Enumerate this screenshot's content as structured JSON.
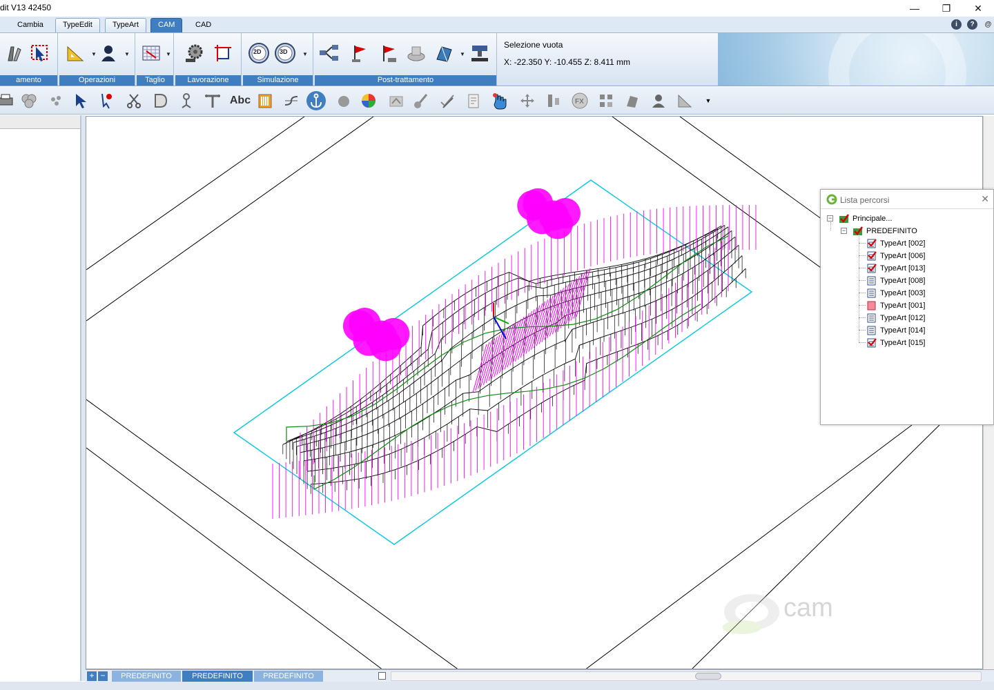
{
  "window": {
    "title": "dit V13 42450",
    "min_glyph": "—",
    "max_glyph": "❐",
    "close_glyph": "✕"
  },
  "menu_tabs": [
    {
      "label": "Cambia",
      "state": "plain"
    },
    {
      "label": "TypeEdit",
      "state": "framed"
    },
    {
      "label": "TypeArt",
      "state": "framed"
    },
    {
      "label": "CAM",
      "state": "active"
    },
    {
      "label": "CAD",
      "state": "plain"
    }
  ],
  "help_icons": [
    "i",
    "?",
    "@"
  ],
  "ribbon": {
    "groups": [
      {
        "label": "amento"
      },
      {
        "label": "Operazioni"
      },
      {
        "label": "Taglio"
      },
      {
        "label": "Lavorazione"
      },
      {
        "label": "Simulazione"
      },
      {
        "label": "Post-trattamento"
      }
    ],
    "selection_text": "Selezione vuota",
    "coords_text": "X: -22.350   Y: -10.455   Z: 8.411  mm",
    "sim2d_label": "2D",
    "sim3d_label": "3D"
  },
  "toolbar": {
    "abc_label": "Abc"
  },
  "lista_percorsi": {
    "title": "Lista percorsi",
    "close_glyph": "✕",
    "root": "Principale...",
    "group": "PREDEFINITO",
    "items": [
      {
        "label": "TypeArt [002]",
        "icon": "checked-doc-icon"
      },
      {
        "label": "TypeArt [006]",
        "icon": "checked-doc-icon"
      },
      {
        "label": "TypeArt [013]",
        "icon": "checked-doc-icon"
      },
      {
        "label": "TypeArt [008]",
        "icon": "doc-icon"
      },
      {
        "label": "TypeArt [003]",
        "icon": "doc-icon"
      },
      {
        "label": "TypeArt [001]",
        "icon": "red-doc-icon"
      },
      {
        "label": "TypeArt [012]",
        "icon": "doc-icon"
      },
      {
        "label": "TypeArt [014]",
        "icon": "doc-icon"
      },
      {
        "label": "TypeArt [015]",
        "icon": "checked-doc-icon"
      }
    ]
  },
  "bottom_tabs": [
    {
      "label": "PREDEFINITO",
      "active": false
    },
    {
      "label": "PREDEFINITO",
      "active": true
    },
    {
      "label": "PREDEFINITO",
      "active": false
    }
  ],
  "add_glyph": "+",
  "remove_glyph": "−",
  "watermark": "cam",
  "colors": {
    "accent": "#3f7fc1",
    "toolpath": "#ff00ff",
    "mesh": "#000000",
    "stock": "#00c8e6",
    "contour": "#0a8a0a"
  }
}
